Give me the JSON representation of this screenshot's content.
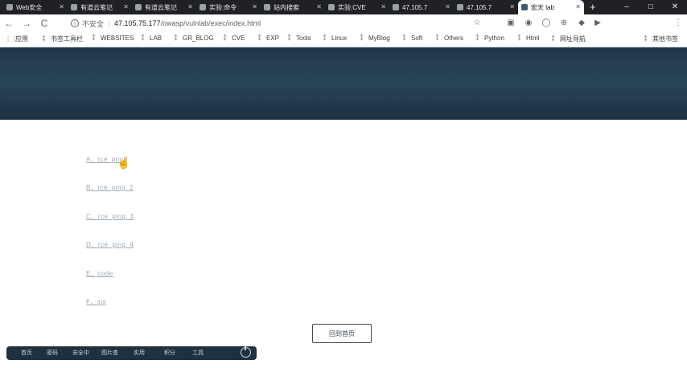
{
  "tabs": [
    {
      "title": "Web安全",
      "active": false
    },
    {
      "title": "有道云笔记",
      "active": false
    },
    {
      "title": "有道云笔记",
      "active": false
    },
    {
      "title": "实验:命令",
      "active": false
    },
    {
      "title": "站内搜索",
      "active": false
    },
    {
      "title": "实验:CVE",
      "active": false
    },
    {
      "title": "47.105.7",
      "active": false
    },
    {
      "title": "47.105.7",
      "active": false
    },
    {
      "title": "宏天 lab",
      "active": true
    }
  ],
  "window_controls": {
    "minimize": "–",
    "maximize": "□",
    "close": "✕"
  },
  "toolbar": {
    "back": "←",
    "forward": "→",
    "reload": "C",
    "security_label": "不安全",
    "url_host": "47.105.75.177",
    "url_path": "/owasp/vulnlab/exec/index.html"
  },
  "bookmarks": [
    {
      "label": "应用",
      "icon": "apps-icon"
    },
    {
      "label": "书签工具栏",
      "icon": "folder-icon"
    },
    {
      "label": "WEBSITES",
      "icon": "folder-icon"
    },
    {
      "label": "LAB",
      "icon": "folder-icon"
    },
    {
      "label": "GR_BLOG",
      "icon": "folder-icon"
    },
    {
      "label": "CVE",
      "icon": "folder-icon"
    },
    {
      "label": "EXP",
      "icon": "folder-icon"
    },
    {
      "label": "Tools",
      "icon": "folder-icon"
    },
    {
      "label": "Linux",
      "icon": "folder-icon"
    },
    {
      "label": "MyBlog",
      "icon": "folder-icon"
    },
    {
      "label": "Soft",
      "icon": "folder-icon"
    },
    {
      "label": "Others",
      "icon": "folder-icon"
    },
    {
      "label": "Python",
      "icon": "folder-icon"
    },
    {
      "label": "Html",
      "icon": "folder-icon"
    },
    {
      "label": "网址导航",
      "icon": "folder-icon"
    },
    {
      "label": "其他书签",
      "icon": "folder-icon"
    }
  ],
  "links": [
    "A、rce_ping",
    "B、rce_ping_2",
    "C、rce_ping_3",
    "D、rce_ping_4",
    "E、code",
    "F、sis"
  ],
  "back_home_label": "回到首页",
  "bottom_bar": [
    "首页",
    "密码",
    "安全中",
    "图片查",
    "实用",
    "积分",
    "工具"
  ]
}
